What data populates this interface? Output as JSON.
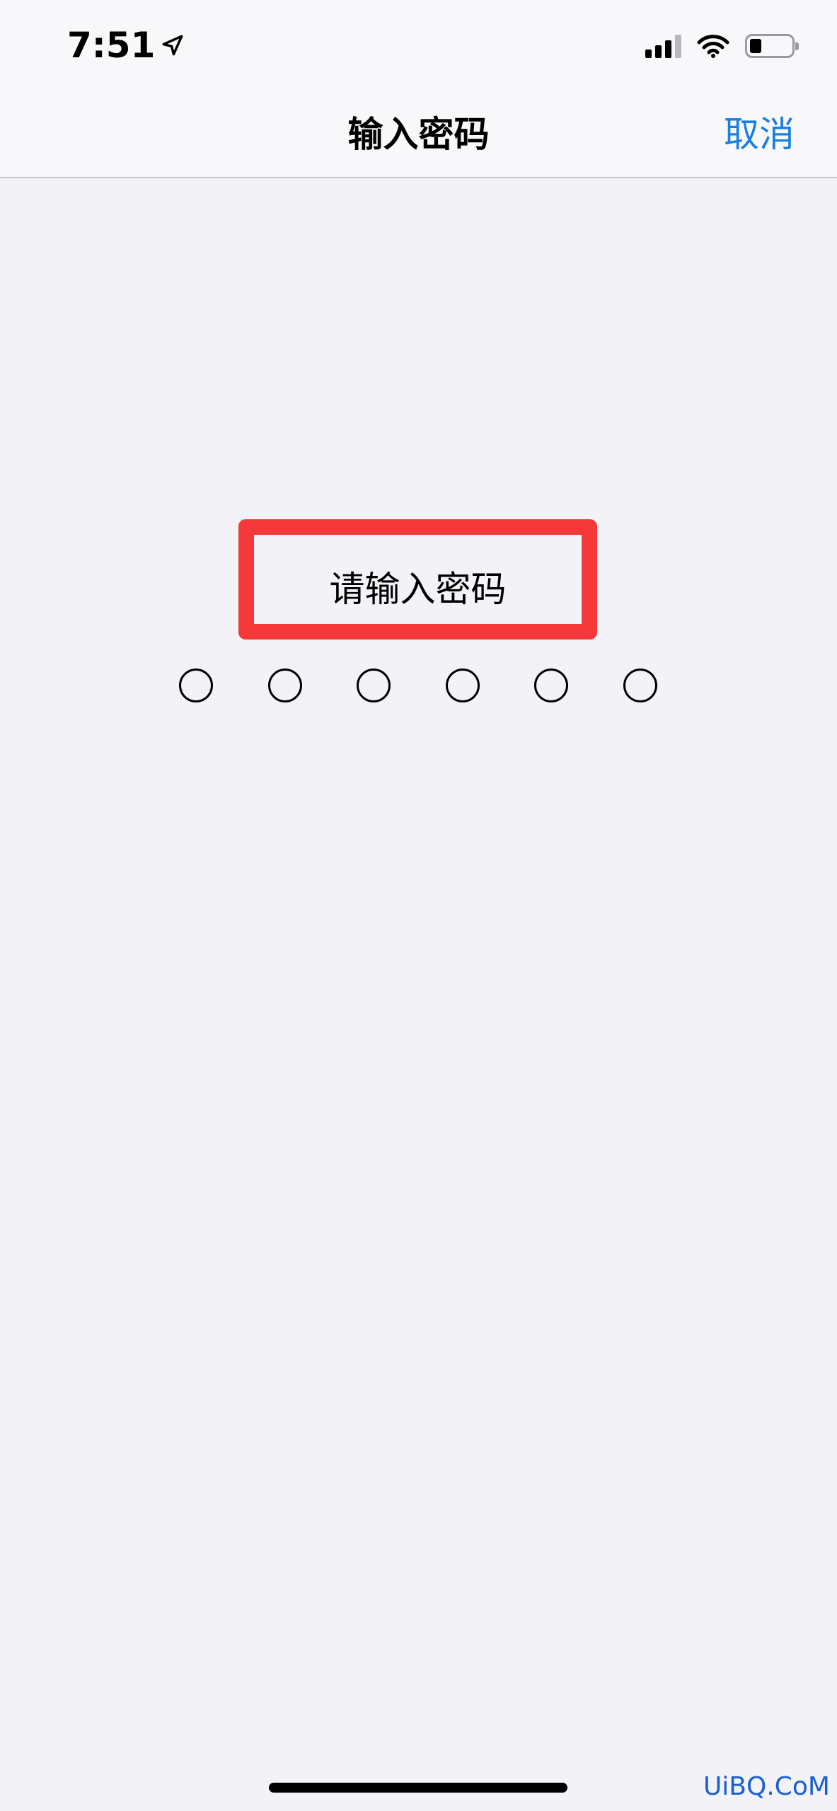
{
  "status_bar": {
    "time": "7:51"
  },
  "nav": {
    "title": "输入密码",
    "cancel_label": "取消"
  },
  "prompt": {
    "text": "请输入密码"
  },
  "passcode": {
    "length": 6,
    "entered": 0
  },
  "watermark": "UiBQ.CoM",
  "colors": {
    "accent": "#1a7fe0",
    "highlight_box": "#f5393a",
    "background": "#f2f2f7"
  }
}
